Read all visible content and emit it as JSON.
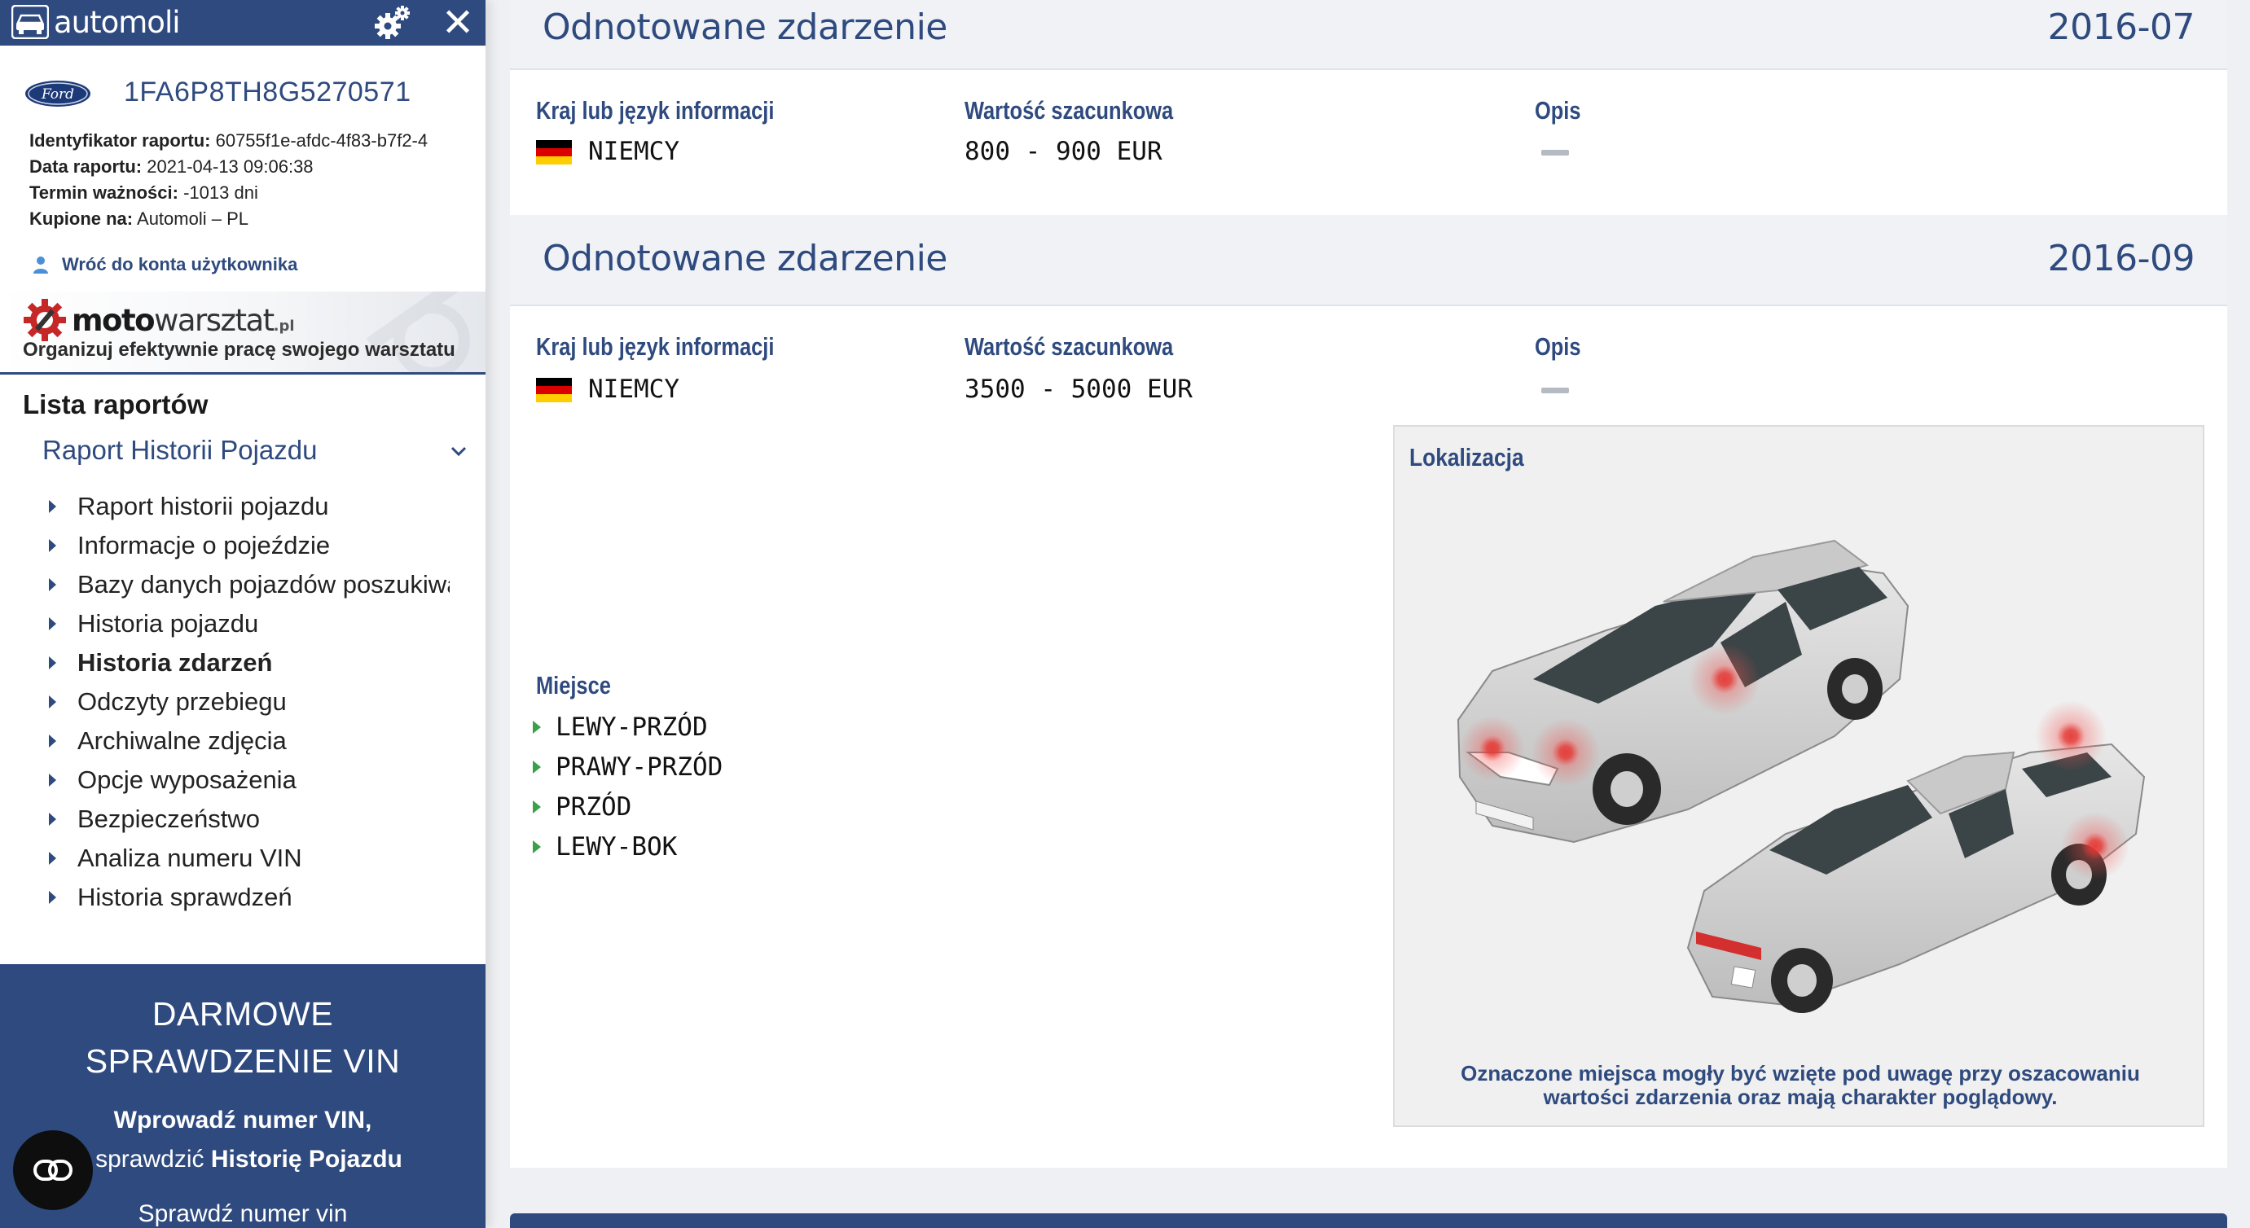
{
  "app": {
    "brand": "automoli",
    "brand_icon": "car-logo-icon",
    "settings_icon": "gears-icon",
    "close_icon": "close-icon",
    "accent_color": "#2e4a7e"
  },
  "vehicle": {
    "make_logo": "Ford",
    "vin": "1FA6P8TH8G5270571"
  },
  "report_meta": {
    "id_label": "Identyfikator raportu:",
    "id_value": "60755f1e-afdc-4f83-b7f2-4",
    "date_label": "Data raportu:",
    "date_value": "2021-04-13 09:06:38",
    "validity_label": "Termin ważności:",
    "validity_value": "-1013 dni",
    "bought_label": "Kupione na:",
    "bought_value": "Automoli – PL"
  },
  "back_link": "Wróć do konta użytkownika",
  "promo": {
    "name_bold": "moto",
    "name_light": "warsztat",
    "name_suffix": ".pl",
    "tagline": "Organizuj efektywnie pracę swojego warsztatu"
  },
  "sidebar": {
    "list_title": "Lista raportów",
    "section_label": "Raport Historii Pojazdu",
    "items": [
      {
        "label": "Raport historii pojazdu"
      },
      {
        "label": "Informacje o pojeździe"
      },
      {
        "label": "Bazy danych pojazdów poszukiwanych"
      },
      {
        "label": "Historia pojazdu"
      },
      {
        "label": "Historia zdarzeń"
      },
      {
        "label": "Odczyty przebiegu"
      },
      {
        "label": "Archiwalne zdjęcia"
      },
      {
        "label": "Opcje wyposażenia"
      },
      {
        "label": "Bezpieczeństwo"
      },
      {
        "label": "Analiza numeru VIN"
      },
      {
        "label": "Historia sprawdzeń"
      }
    ],
    "active_item": "Historia zdarzeń"
  },
  "cta": {
    "line1": "DARMOWE",
    "line2": "SPRAWDZENIE VIN",
    "sub1": "Wprowadź numer VIN,",
    "sub2_prefix": "i sprawdzić",
    "sub2_bold": "Historię Pojazdu",
    "link": "Sprawdź numer vin"
  },
  "events": [
    {
      "title": "Odnotowane zdarzenie",
      "date": "2016-07",
      "country_label": "Kraj lub język informacji",
      "country": "NIEMCY",
      "value_label": "Wartość szacunkowa",
      "value": "800 - 900 EUR",
      "desc_label": "Opis"
    },
    {
      "title": "Odnotowane zdarzenie",
      "date": "2016-09",
      "country_label": "Kraj lub język informacji",
      "country": "NIEMCY",
      "value_label": "Wartość szacunkowa",
      "value": "3500 - 5000 EUR",
      "desc_label": "Opis",
      "place_label": "Miejsce",
      "places": [
        "LEWY-PRZÓD",
        "PRAWY-PRZÓD",
        "PRZÓD",
        "LEWY-BOK"
      ],
      "location_label": "Lokalizacja",
      "location_note": "Oznaczone miejsca mogły być wzięte pod uwagę przy oszacowaniu wartości zdarzenia oraz mają charakter poglądowy."
    }
  ],
  "flag_colors": [
    "#000000",
    "#dd0000",
    "#ffce00"
  ]
}
